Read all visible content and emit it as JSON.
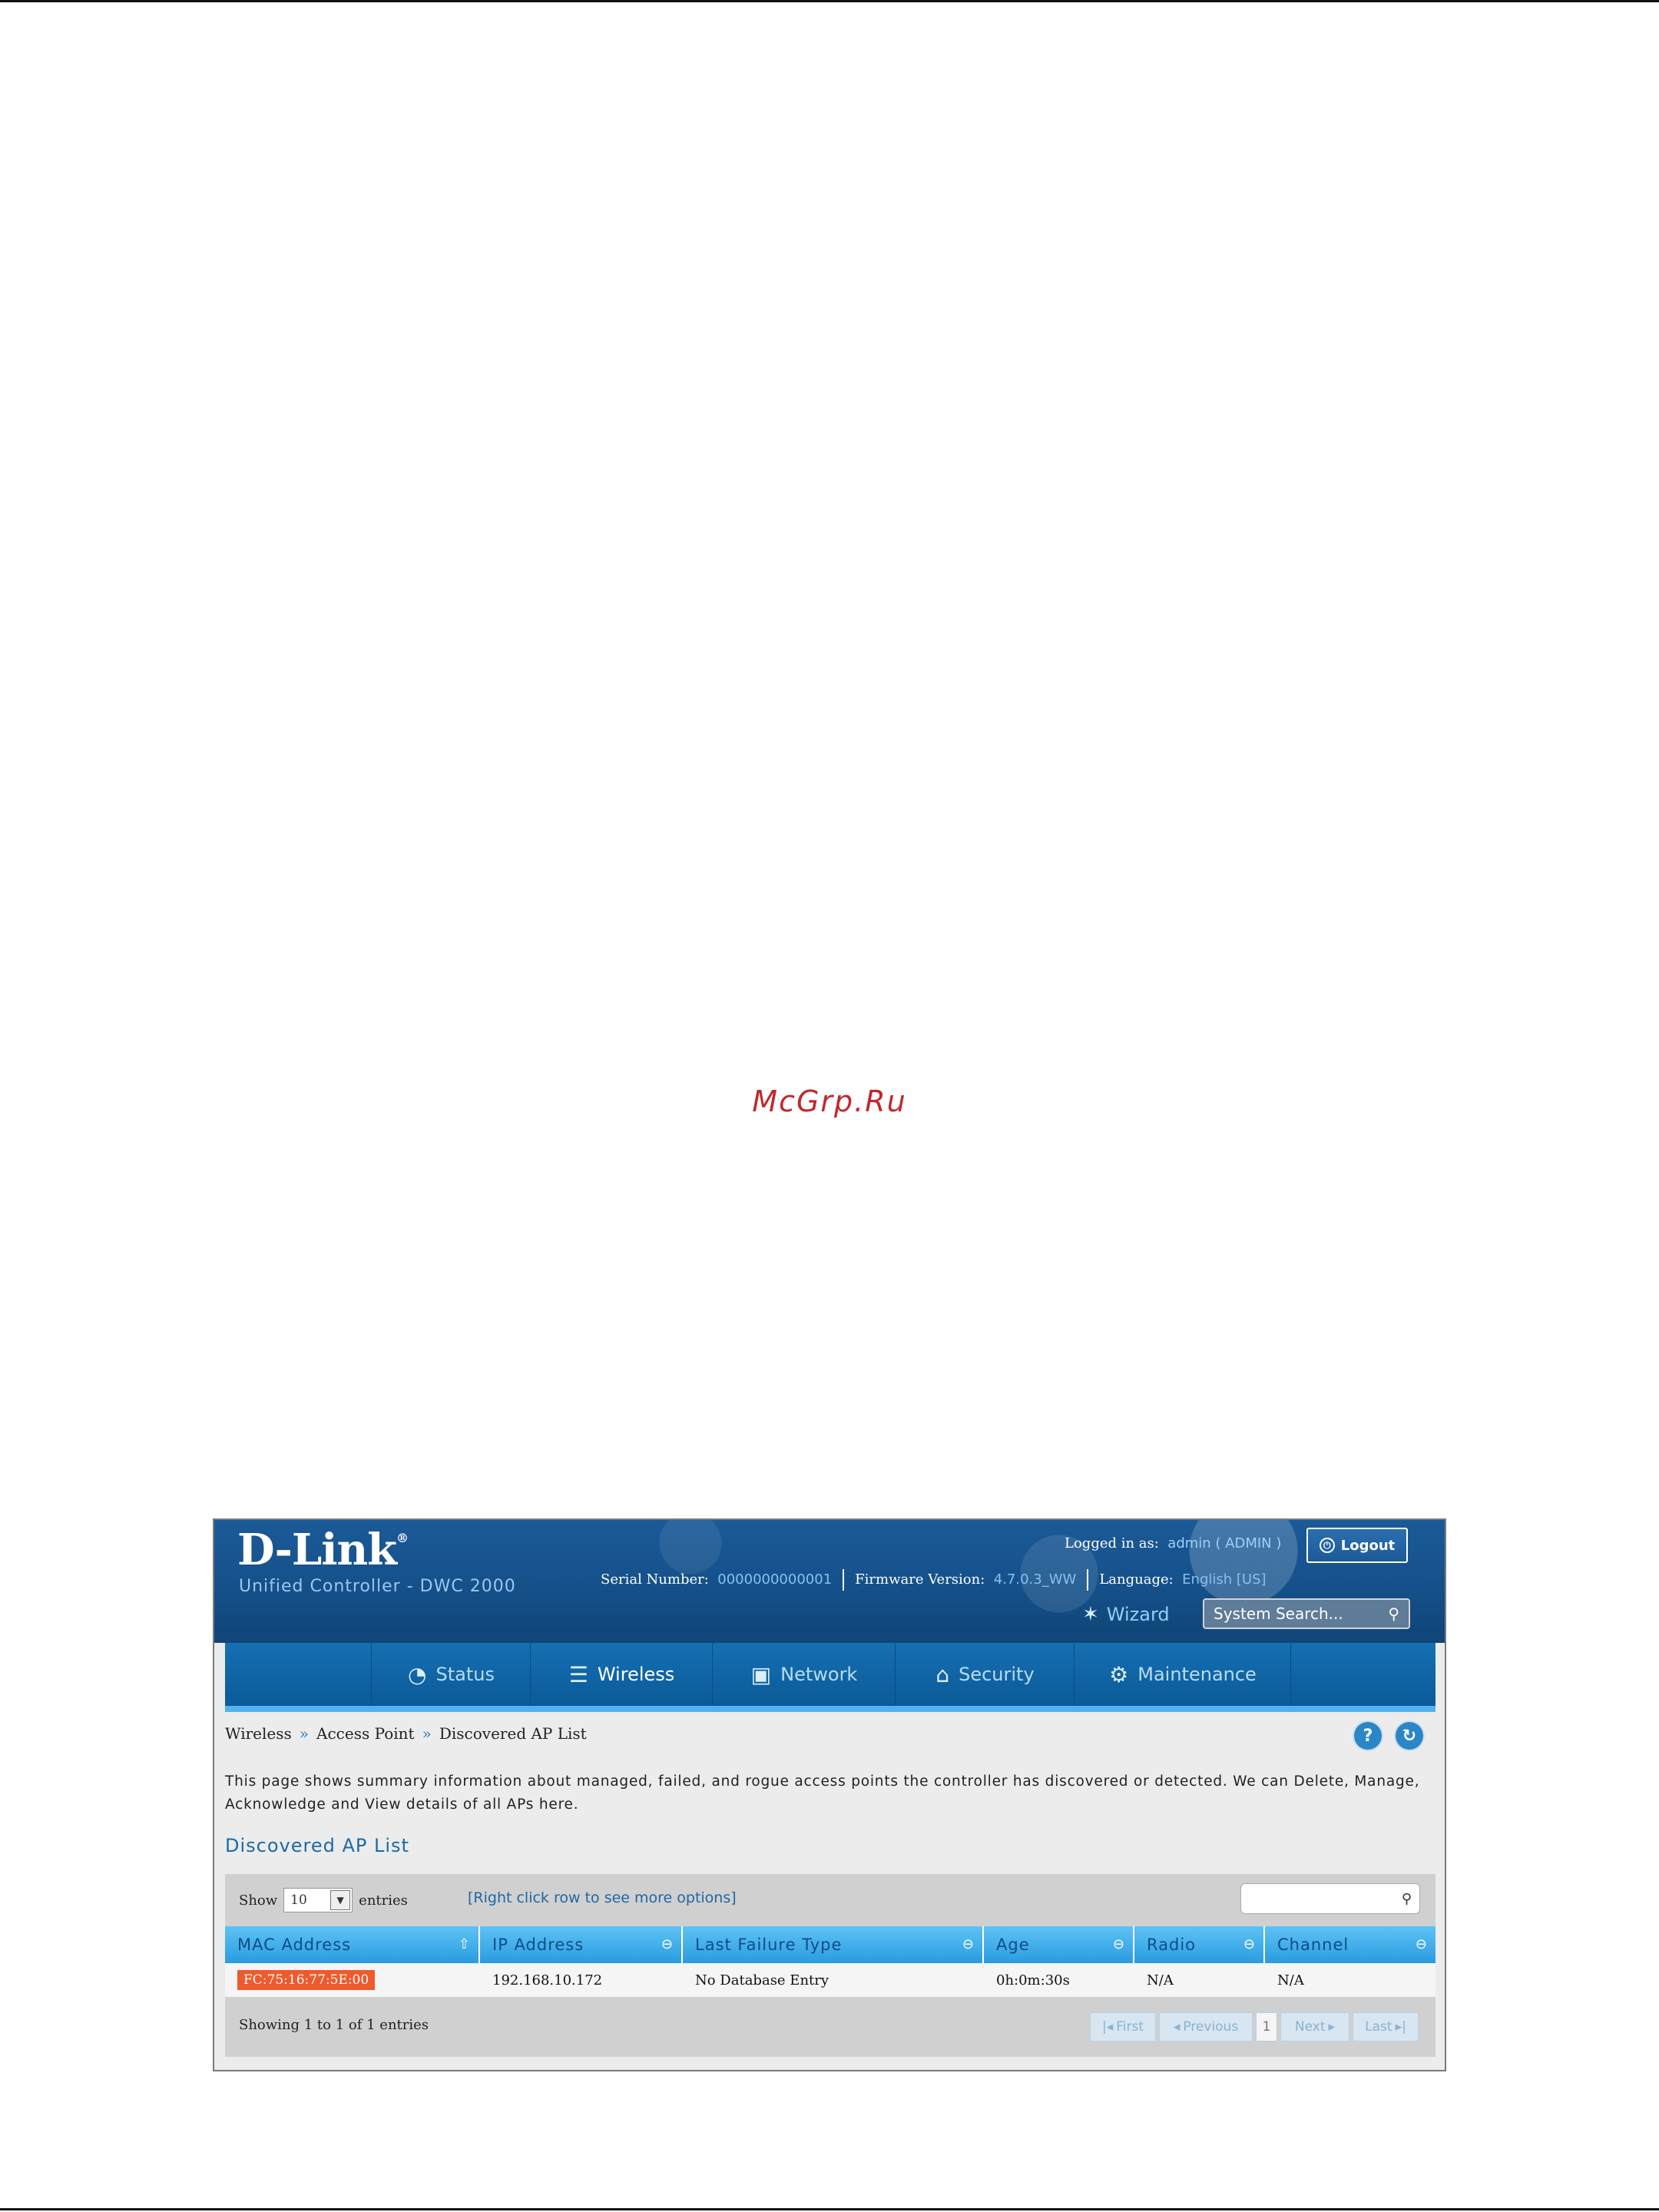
{
  "watermark": "McGrp.Ru",
  "header": {
    "logo": "D-Link",
    "logo_mark": "®",
    "subtitle": "Unified Controller - DWC 2000",
    "serial_label": "Serial Number:",
    "serial_value": "0000000000001",
    "firmware_label": "Firmware Version:",
    "firmware_value": "4.7.0.3_WW",
    "language_label": "Language:",
    "language_value": "English [US]",
    "logged_label": "Logged in as:",
    "logged_value": "admin ( ADMIN )",
    "logout_label": "Logout",
    "wizard_label": "Wizard",
    "search_placeholder": "System Search..."
  },
  "nav": {
    "items": [
      {
        "label": "Status",
        "icon": "gauge-icon"
      },
      {
        "label": "Wireless",
        "icon": "wifi-icon"
      },
      {
        "label": "Network",
        "icon": "monitor-icon"
      },
      {
        "label": "Security",
        "icon": "lock-icon"
      },
      {
        "label": "Maintenance",
        "icon": "gears-icon"
      }
    ],
    "active": "Wireless"
  },
  "breadcrumb": [
    "Wireless",
    "Access Point",
    "Discovered AP List"
  ],
  "breadcrumb_separator": "»",
  "description": "This page shows summary information about managed, failed, and rogue access points the controller has discovered or detected. We can Delete, Manage, Acknowledge and View details of all APs here.",
  "section_title": "Discovered AP List",
  "table": {
    "show_label": "Show",
    "show_value": "10",
    "entries_label": "entries",
    "hint": "[Right click row to see more options]",
    "columns": [
      "MAC Address",
      "IP Address",
      "Last Failure Type",
      "Age",
      "Radio",
      "Channel"
    ],
    "rows": [
      {
        "mac": "FC:75:16:77:5E:00",
        "ip": "192.168.10.172",
        "failure": "No Database Entry",
        "age": "0h:0m:30s",
        "radio": "N/A",
        "channel": "N/A"
      }
    ],
    "footer": "Showing 1 to 1 of 1 entries",
    "pager": {
      "first": "First",
      "previous": "Previous",
      "page": "1",
      "next": "Next",
      "last": "Last"
    }
  }
}
